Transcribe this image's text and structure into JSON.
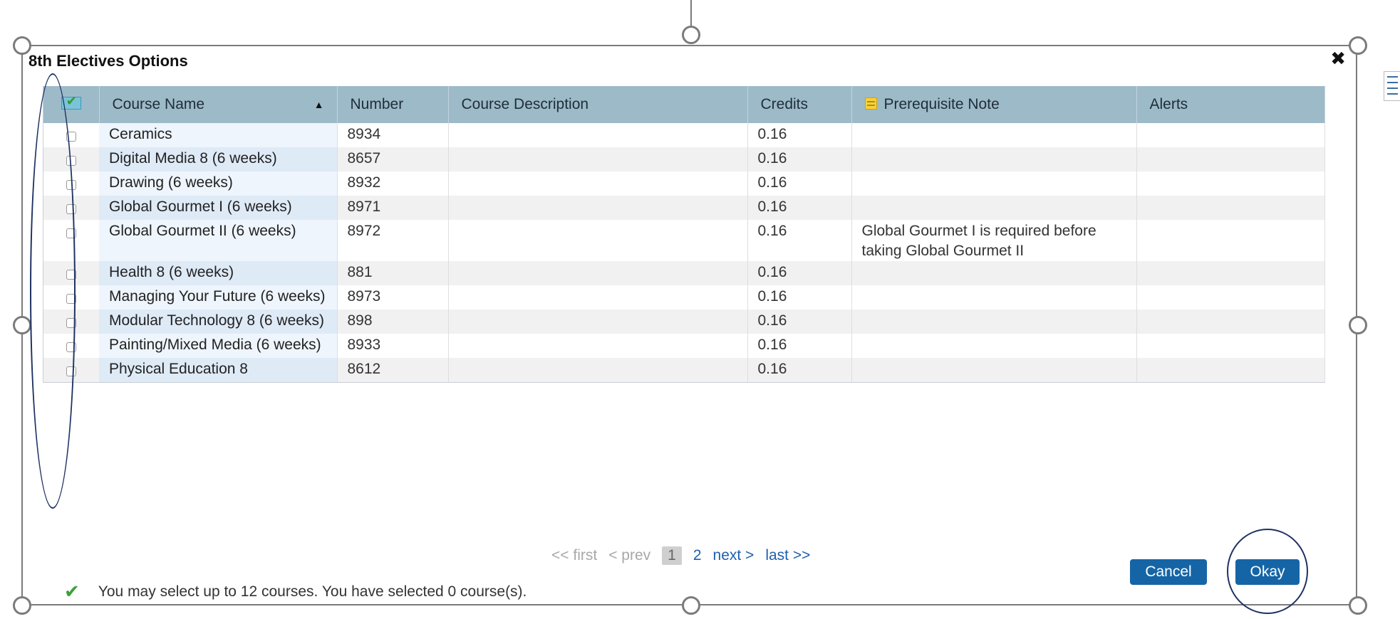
{
  "dialog": {
    "title": "8th Electives Options",
    "close_glyph": "✖"
  },
  "table": {
    "columns": [
      "Course Name",
      "Number",
      "Course Description",
      "Credits",
      "Prerequisite Note",
      "Alerts"
    ],
    "sort_column": "Course Name",
    "sort_direction": "ascending",
    "rows": [
      {
        "name": "Ceramics",
        "number": "8934",
        "description": "",
        "credits": "0.16",
        "note": "",
        "alerts": "",
        "checked": false
      },
      {
        "name": "Digital Media 8 (6 weeks)",
        "number": "8657",
        "description": "",
        "credits": "0.16",
        "note": "",
        "alerts": "",
        "checked": false
      },
      {
        "name": "Drawing (6 weeks)",
        "number": "8932",
        "description": "",
        "credits": "0.16",
        "note": "",
        "alerts": "",
        "checked": false
      },
      {
        "name": "Global Gourmet I (6 weeks)",
        "number": "8971",
        "description": "",
        "credits": "0.16",
        "note": "",
        "alerts": "",
        "checked": false
      },
      {
        "name": "Global Gourmet II (6 weeks)",
        "number": "8972",
        "description": "",
        "credits": "0.16",
        "note": "Global Gourmet I is required before taking Global Gourmet II",
        "alerts": "",
        "checked": false
      },
      {
        "name": "Health 8 (6 weeks)",
        "number": "881",
        "description": "",
        "credits": "0.16",
        "note": "",
        "alerts": "",
        "checked": false
      },
      {
        "name": "Managing Your Future (6 weeks)",
        "number": "8973",
        "description": "",
        "credits": "0.16",
        "note": "",
        "alerts": "",
        "checked": false
      },
      {
        "name": "Modular Technology 8 (6 weeks)",
        "number": "898",
        "description": "",
        "credits": "0.16",
        "note": "",
        "alerts": "",
        "checked": false
      },
      {
        "name": "Painting/Mixed Media (6 weeks)",
        "number": "8933",
        "description": "",
        "credits": "0.16",
        "note": "",
        "alerts": "",
        "checked": false
      },
      {
        "name": "Physical Education 8",
        "number": "8612",
        "description": "",
        "credits": "0.16",
        "note": "",
        "alerts": "",
        "checked": false
      }
    ]
  },
  "pagination": {
    "first": "<< first",
    "prev": "< prev",
    "current": "1",
    "page2": "2",
    "next": "next >",
    "last": "last >>"
  },
  "status": {
    "message": "You may select up to 12 courses.  You have selected 0 course(s)."
  },
  "buttons": {
    "cancel": "Cancel",
    "okay": "Okay"
  },
  "colors": {
    "header_bg": "#9dbac8",
    "button_bg": "#1565a6",
    "link": "#1f5fae",
    "annotation": "#1e3262"
  }
}
